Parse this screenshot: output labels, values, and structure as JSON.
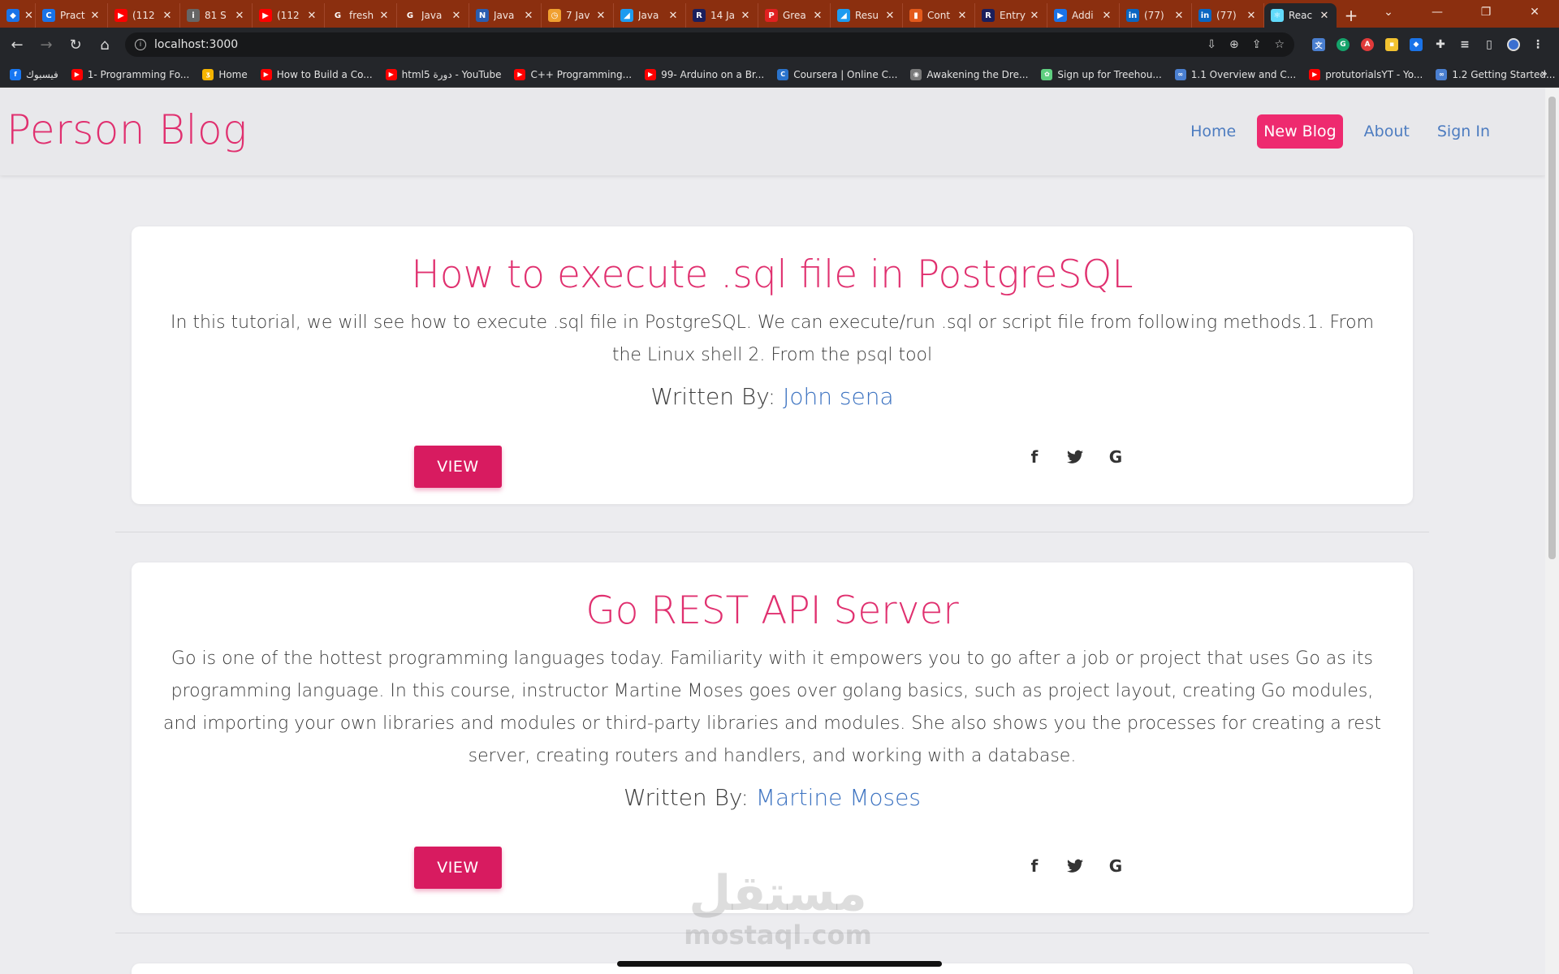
{
  "browser": {
    "tabs": [
      {
        "title": "",
        "favicon": "gem-icon",
        "color": "#1a73e8",
        "glyph": "◆"
      },
      {
        "title": "Pract",
        "favicon": "c-icon",
        "color": "#1a73e8",
        "glyph": "C"
      },
      {
        "title": "(112",
        "favicon": "youtube-icon",
        "color": "#ff0000",
        "glyph": "▶"
      },
      {
        "title": "81 S",
        "favicon": "info-icon",
        "color": "#666666",
        "glyph": "i"
      },
      {
        "title": "(112",
        "favicon": "youtube-icon",
        "color": "#ff0000",
        "glyph": "▶"
      },
      {
        "title": "fresh",
        "favicon": "google-icon",
        "color": "#ffffff",
        "glyph": "G"
      },
      {
        "title": "Java",
        "favicon": "google-icon",
        "color": "#ffffff",
        "glyph": "G"
      },
      {
        "title": "Java",
        "favicon": "n-icon",
        "color": "#2a5db0",
        "glyph": "N"
      },
      {
        "title": "7 Jav",
        "favicon": "clock-icon",
        "color": "#f0a030",
        "glyph": "◷"
      },
      {
        "title": "Java",
        "favicon": "bird-icon",
        "color": "#1d9bf0",
        "glyph": "◢"
      },
      {
        "title": "14 Ja",
        "favicon": "r-icon",
        "color": "#1b1f5c",
        "glyph": "R"
      },
      {
        "title": "Grea",
        "favicon": "p-icon",
        "color": "#e02020",
        "glyph": "P"
      },
      {
        "title": "Resu",
        "favicon": "bird-icon",
        "color": "#1d9bf0",
        "glyph": "◢"
      },
      {
        "title": "Cont",
        "favicon": "bars-icon",
        "color": "#e35a1c",
        "glyph": "▮"
      },
      {
        "title": "Entry",
        "favicon": "r-icon",
        "color": "#1b1f5c",
        "glyph": "R"
      },
      {
        "title": "Addi",
        "favicon": "video-icon",
        "color": "#1a73e8",
        "glyph": "▶"
      },
      {
        "title": "(77)",
        "favicon": "linkedin-icon",
        "color": "#0a66c2",
        "glyph": "in"
      },
      {
        "title": "(77)",
        "favicon": "linkedin-icon",
        "color": "#0a66c2",
        "glyph": "in"
      },
      {
        "title": "Reac",
        "favicon": "react-icon",
        "color": "#61dafb",
        "glyph": "⚛"
      }
    ],
    "url": "localhost:3000",
    "bookmarks": [
      {
        "label": "فيسبوك",
        "favicon": "facebook-icon",
        "color": "#1877f2",
        "glyph": "f"
      },
      {
        "label": "1- Programming Fo...",
        "favicon": "youtube-icon",
        "color": "#ff0000",
        "glyph": "▶"
      },
      {
        "label": "Home",
        "favicon": "home-icon",
        "color": "#f5b400",
        "glyph": "ʒ"
      },
      {
        "label": "How to Build a Co...",
        "favicon": "youtube-icon",
        "color": "#ff0000",
        "glyph": "▶"
      },
      {
        "label": "html5 دورة - YouTube",
        "favicon": "youtube-icon",
        "color": "#ff0000",
        "glyph": "▶"
      },
      {
        "label": "C++ Programming...",
        "favicon": "youtube-icon",
        "color": "#ff0000",
        "glyph": "▶"
      },
      {
        "label": "99- Arduino on a Br...",
        "favicon": "youtube-icon",
        "color": "#ff0000",
        "glyph": "▶"
      },
      {
        "label": "Coursera | Online C...",
        "favicon": "coursera-icon",
        "color": "#2a73cc",
        "glyph": "C"
      },
      {
        "label": "Awakening the Dre...",
        "favicon": "globe-icon",
        "color": "#7a7a7a",
        "glyph": "◉"
      },
      {
        "label": "Sign up for Treehou...",
        "favicon": "treehouse-icon",
        "color": "#5fcf80",
        "glyph": "✿"
      },
      {
        "label": "1.1 Overview and C...",
        "favicon": "infinity-icon",
        "color": "#4a7fd0",
        "glyph": "∞"
      },
      {
        "label": "protutorialsYT - Yo...",
        "favicon": "youtube-icon",
        "color": "#ff0000",
        "glyph": "▶"
      },
      {
        "label": "1.2 Getting Started...",
        "favicon": "infinity-icon",
        "color": "#4a7fd0",
        "glyph": "∞"
      }
    ]
  },
  "site": {
    "brand": "Person Blog",
    "nav": [
      {
        "label": "Home",
        "active": false
      },
      {
        "label": "New Blog",
        "active": true
      },
      {
        "label": "About",
        "active": false
      },
      {
        "label": "Sign In",
        "active": false
      }
    ],
    "accent_color": "#e0306f",
    "link_color": "#3d73c1"
  },
  "posts": [
    {
      "title": "How to execute .sql file in PostgreSQL",
      "description": "In this tutorial, we will see how to execute .sql file in PostgreSQL. We can execute/run .sql or script file from following methods.1. From the Linux shell 2. From the psql tool",
      "author_prefix": "Written By:",
      "author": "John sena",
      "button_label": "VIEW"
    },
    {
      "title": "Go REST API Server",
      "description": "Go is one of the hottest programming languages today. Familiarity with it empowers you to go after a job or project that uses Go as its programming language. In this course, instructor Martine Moses goes over golang basics, such as project layout, creating Go modules, and importing your own libraries and modules or third-party libraries and modules. She also shows you the processes for creating a rest server, creating routers and handlers, and working with a database.",
      "author_prefix": "Written By:",
      "author": "Martine Moses",
      "button_label": "VIEW"
    }
  ],
  "social_icons": [
    "facebook-icon",
    "twitter-icon",
    "google-icon"
  ],
  "watermark": {
    "arabic": "مستقل",
    "latin": "mostaql.com"
  }
}
